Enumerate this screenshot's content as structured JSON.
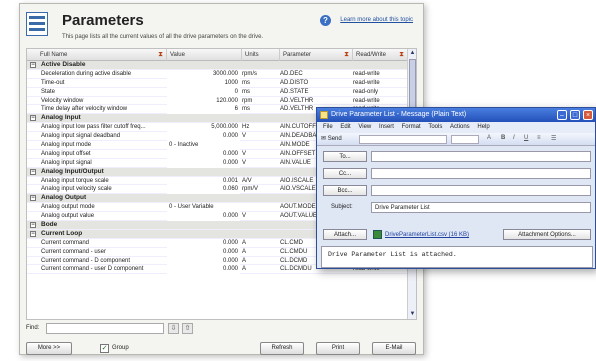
{
  "panel": {
    "title": "Parameters",
    "subtitle": "This page lists all the current values of all the drive parameters on the drive.",
    "learn_more": "Learn more about this topic"
  },
  "columns": [
    "Full Name",
    "Value",
    "Units",
    "Parameter",
    "Read/Write"
  ],
  "groups": [
    {
      "name": "Active Disable",
      "rows": [
        [
          "Deceleration during active disable",
          "3000.000",
          "rpm/s",
          "AD.DEC",
          "read-write"
        ],
        [
          "Time-out",
          "1000",
          "ms",
          "AD.DISTO",
          "read-write"
        ],
        [
          "State",
          "0",
          "ms",
          "AD.STATE",
          "read-only"
        ],
        [
          "Velocity window",
          "120.000",
          "rpm",
          "AD.VELTHR",
          "read-write"
        ],
        [
          "Time delay after velocity window",
          "6",
          "ms",
          "AD.VELTHR",
          "read-write"
        ]
      ]
    },
    {
      "name": "Analog Input",
      "rows": [
        [
          "Analog input low pass filter cutoff freq...",
          "5,000.000",
          "Hz",
          "AIN.CUTOFF",
          "read-write"
        ],
        [
          "Analog input signal deadband",
          "0.000",
          "V",
          "AIN.DEADBA",
          "read-write"
        ],
        [
          "Analog input mode",
          "0 - Inactive",
          "",
          "AIN.MODE",
          "read-write"
        ],
        [
          "Analog input offset",
          "0.000",
          "V",
          "AIN.OFFSET",
          "read-write"
        ],
        [
          "Analog input signal",
          "0.000",
          "V",
          "AIN.VALUE",
          "read-only"
        ]
      ]
    },
    {
      "name": "Analog Input/Output",
      "rows": [
        [
          "Analog input torque scale",
          "0.001",
          "A/V",
          "AIO.ISCALE",
          "read-write"
        ],
        [
          "Analog input velocity scale",
          "0.060",
          "rpm/V",
          "AIO.VSCALE",
          "read-write"
        ]
      ]
    },
    {
      "name": "Analog Output",
      "rows": [
        [
          "Analog output mode",
          "0 - User Variable",
          "",
          "AOUT.MODE",
          "read-write"
        ],
        [
          "Analog output value",
          "0.000",
          "V",
          "AOUT.VALUE",
          "read-write"
        ]
      ]
    },
    {
      "name": "Bode",
      "rows": []
    },
    {
      "name": "Current Loop",
      "rows": [
        [
          "Current command",
          "0.000",
          "A",
          "CL.CMD",
          "read-only"
        ],
        [
          "Current command - user",
          "0.000",
          "A",
          "CL.CMDU",
          "read-write"
        ],
        [
          "Current command - D component",
          "0.000",
          "A",
          "CL.DCMD",
          "read-only"
        ],
        [
          "Current command - user D component",
          "0.000",
          "A",
          "CL.DCMDU",
          "read-write"
        ]
      ]
    }
  ],
  "footer": {
    "find_label": "Find:",
    "more_btn": "More >>",
    "group_label": "Group",
    "refresh_btn": "Refresh",
    "print_btn": "Print",
    "email_btn": "E-Mail"
  },
  "message": {
    "title": "Drive Parameter List - Message (Plain Text)",
    "menu": [
      "File",
      "Edit",
      "View",
      "Insert",
      "Format",
      "Tools",
      "Actions",
      "Help"
    ],
    "send": "Send",
    "to_btn": "To...",
    "cc_btn": "Cc...",
    "bcc_btn": "Bcc...",
    "subject_label": "Subject:",
    "subject_value": "Drive Parameter List",
    "attach_btn": "Attach...",
    "attachment": "DriveParameterList.csv (16 KB)",
    "attach_options": "Attachment Options...",
    "body": "Drive Parameter List is attached."
  }
}
